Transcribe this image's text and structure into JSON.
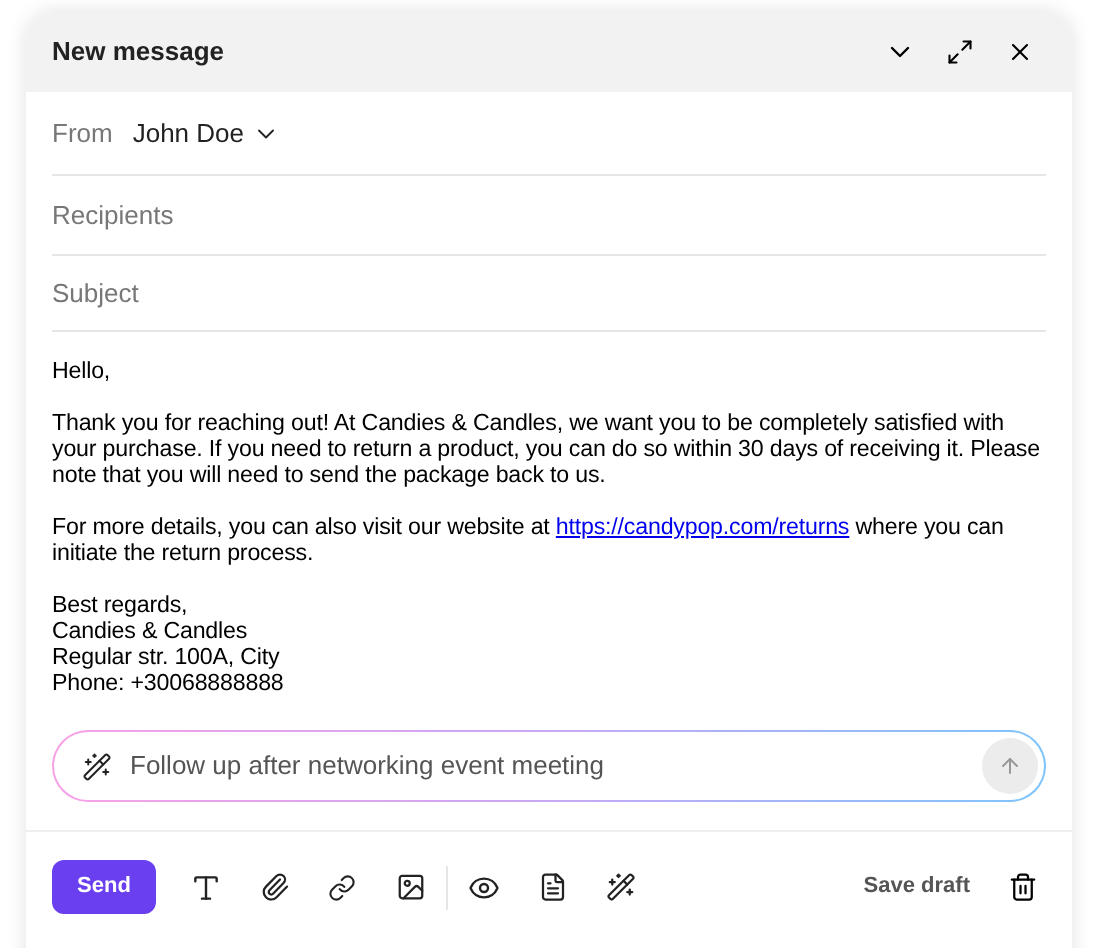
{
  "window": {
    "title": "New message"
  },
  "from": {
    "label": "From",
    "value": "John Doe"
  },
  "recipients": {
    "placeholder": "Recipients"
  },
  "subject": {
    "placeholder": "Subject"
  },
  "body": [
    {
      "kind": "text",
      "text": "Hello,"
    },
    {
      "kind": "text",
      "text": "Thank you for reaching out! At Candies & Candles, we want you to be completely satisfied with your purchase. If you need to return a product, you can do so within 30 days of receiving it. Please note that you will need to send the package back to us."
    },
    {
      "kind": "link",
      "before": "For more details, you can also visit our website at",
      "link": "https://candypop.com/returns",
      "after": "where you can initiate the return process."
    },
    {
      "kind": "lines",
      "lines": [
        "Best regards,",
        "Candies & Candles",
        "Regular str. 100A, City",
        "Phone: +30068888888"
      ]
    }
  ],
  "ai_prompt": {
    "value": "Follow up after networking event meeting"
  },
  "toolbar": {
    "send": "Send",
    "save_draft": "Save draft"
  }
}
